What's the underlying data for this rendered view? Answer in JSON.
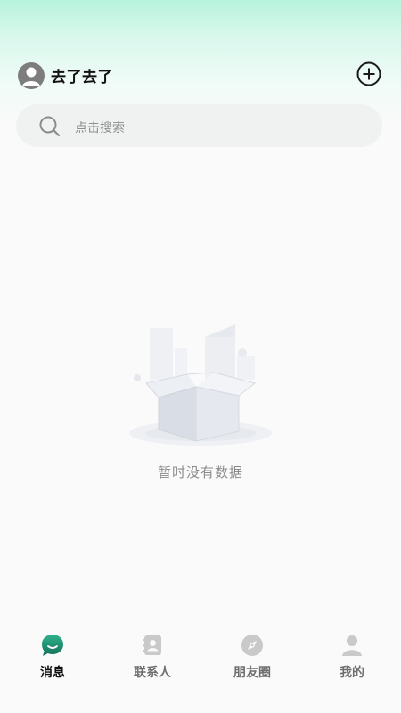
{
  "header": {
    "username": "去了去了"
  },
  "search": {
    "placeholder": "点击搜索"
  },
  "empty_state": {
    "text": "暂时没有数据"
  },
  "tabs": [
    {
      "label": "消息",
      "icon": "chat-bubble-icon",
      "active": true
    },
    {
      "label": "联系人",
      "icon": "contacts-book-icon",
      "active": false
    },
    {
      "label": "朋友圈",
      "icon": "compass-icon",
      "active": false
    },
    {
      "label": "我的",
      "icon": "person-icon",
      "active": false
    }
  ],
  "colors": {
    "accent": "#1f9e7c",
    "inactive_icon": "#c4c4c4",
    "header_gradient_top": "#b7f3dc"
  }
}
